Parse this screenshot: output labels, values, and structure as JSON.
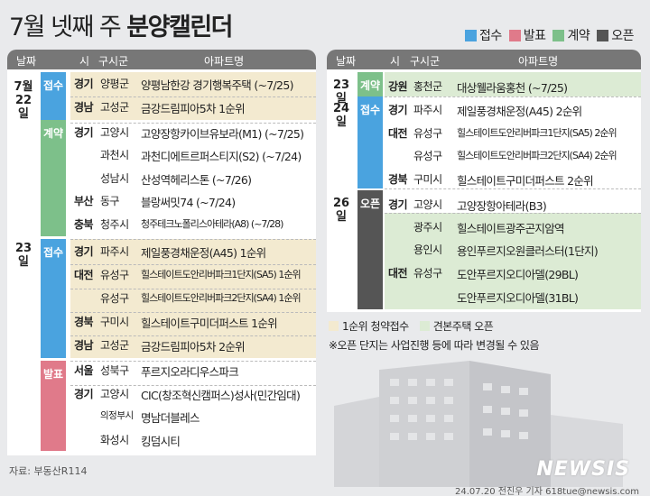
{
  "title": {
    "prefix": "7월 넷째 주 ",
    "bold": "분양캘린더"
  },
  "legend": [
    {
      "label": "접수",
      "color": "#4aa3df"
    },
    {
      "label": "발표",
      "color": "#e07a8a"
    },
    {
      "label": "계약",
      "color": "#7dc08a"
    },
    {
      "label": "오픈",
      "color": "#555555"
    }
  ],
  "headers": {
    "date": "날짜",
    "si": "시",
    "sigungu": "구시군",
    "apt": "아파트명"
  },
  "left_table": [
    {
      "date": "7월\n22일",
      "tags": [
        {
          "label": "접수"
        },
        {
          "label": "계약"
        }
      ]
    },
    {
      "date": "23일",
      "tags": [
        {
          "label": "접수"
        },
        {
          "label": "발표"
        }
      ]
    }
  ],
  "left_rows": [
    {
      "si": "경기",
      "gu": "양평군",
      "apt": "양평남한강 경기행복주택 (~7/25)"
    },
    {
      "si": "경남",
      "gu": "고성군",
      "apt": "금강드림피아5차 1순위"
    },
    {
      "si": "경기",
      "gu": "고양시",
      "apt": "고양장항카이브유보라(M1) (~7/25)"
    },
    {
      "si": "",
      "gu": "과천시",
      "apt": "과천디에트르퍼스티지(S2) (~7/24)"
    },
    {
      "si": "",
      "gu": "성남시",
      "apt": "산성역헤리스톤 (~7/26)"
    },
    {
      "si": "부산",
      "gu": "동구",
      "apt": "블랑써밋74 (~7/24)"
    },
    {
      "si": "충북",
      "gu": "청주시",
      "apt": "청주테크노폴리스아테라(A8) (~7/28)"
    },
    {
      "si": "경기",
      "gu": "파주시",
      "apt": "제일풍경채운정(A45) 1순위"
    },
    {
      "si": "대전",
      "gu": "유성구",
      "apt": "힐스테이트도안리버파크1단지(SA5) 1순위"
    },
    {
      "si": "",
      "gu": "유성구",
      "apt": "힐스테이트도안리버파크2단지(SA4) 1순위"
    },
    {
      "si": "경북",
      "gu": "구미시",
      "apt": "힐스테이트구미더퍼스트 1순위"
    },
    {
      "si": "경남",
      "gu": "고성군",
      "apt": "금강드림피아5차 2순위"
    },
    {
      "si": "서울",
      "gu": "성북구",
      "apt": "푸르지오라디우스파크"
    },
    {
      "si": "경기",
      "gu": "고양시",
      "apt": "CIC(창조혁신캠퍼스)성사(민간임대)"
    },
    {
      "si": "",
      "gu": "의정부시",
      "apt": "명남더블레스"
    },
    {
      "si": "",
      "gu": "화성시",
      "apt": "킹덤시티"
    }
  ],
  "right_table": [
    {
      "date": "23일",
      "tag": "계약"
    },
    {
      "date": "24일",
      "tag": "접수"
    },
    {
      "date": "26일",
      "tag": "오픈"
    }
  ],
  "right_rows": [
    {
      "si": "강원",
      "gu": "홍천군",
      "apt": "대상웰라움홍천 (~7/25)"
    },
    {
      "si": "경기",
      "gu": "파주시",
      "apt": "제일풍경채운정(A45) 2순위"
    },
    {
      "si": "대전",
      "gu": "유성구",
      "apt": "힐스테이트도안리버파크1단지(SA5) 2순위"
    },
    {
      "si": "",
      "gu": "유성구",
      "apt": "힐스테이트도안리버파크2단지(SA4) 2순위"
    },
    {
      "si": "경북",
      "gu": "구미시",
      "apt": "힐스테이트구미더퍼스트 2순위"
    },
    {
      "si": "경기",
      "gu": "고양시",
      "apt": "고양장항아테라(B3)"
    },
    {
      "si": "",
      "gu": "광주시",
      "apt": "힐스테이트광주곤지암역"
    },
    {
      "si": "",
      "gu": "용인시",
      "apt": "용인푸르지오원클러스터(1단지)"
    },
    {
      "si": "대전",
      "gu": "유성구",
      "apt": "도안푸르지오디아델(29BL)"
    },
    {
      "si": "",
      "gu": "",
      "apt": "도안푸르지오디아델(31BL)"
    }
  ],
  "notes": {
    "legend1": "1순위 청약접수",
    "legend2": "견본주택 오픈",
    "legend1_color": "#f3ead0",
    "legend2_color": "#dcebd4",
    "remark": "※오픈 단지는 사업진행 등에 따라 변경될 수 있음"
  },
  "source": "자료: 부동산R114",
  "credit": "24.07.20 전진우 기자 618tue@newsis.com",
  "logo": "NEWSIS"
}
